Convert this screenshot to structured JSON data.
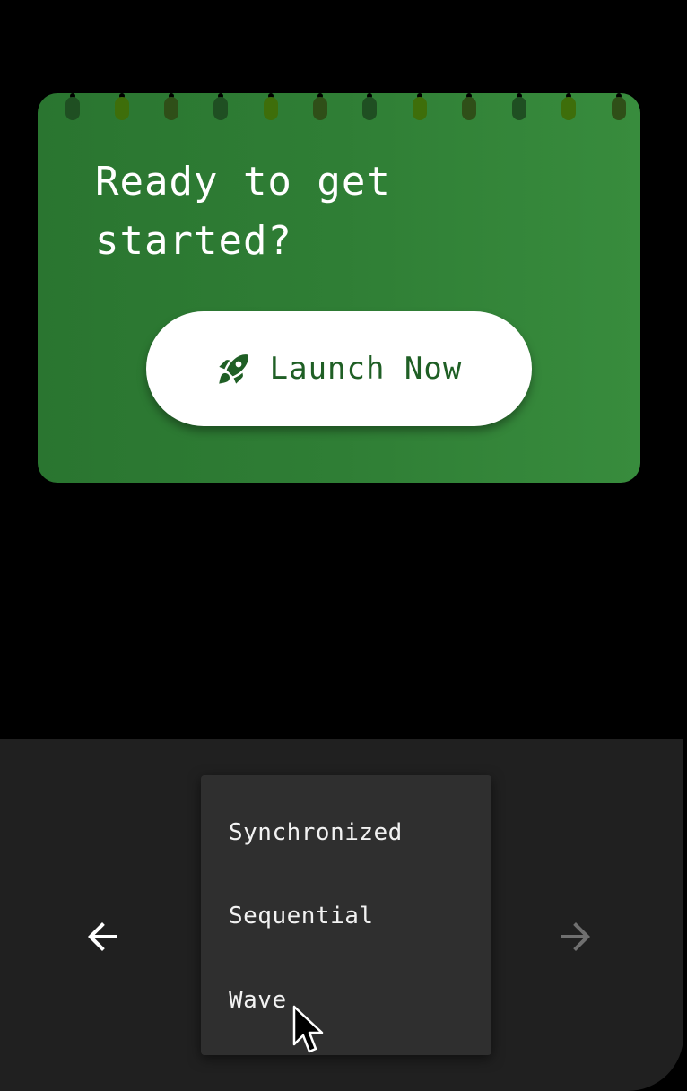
{
  "card": {
    "title": "Ready to get started?",
    "button_label": "Launch Now",
    "button_icon": "rocket-icon",
    "background_color": "#2f7e35",
    "ring_colors": [
      "#1f4f22",
      "#3e6e0a",
      "#2f4f18",
      "#1f4f22",
      "#3e6e0a",
      "#2f4f18",
      "#1f4f22",
      "#3e6e0a",
      "#2f4f18",
      "#1f4f22",
      "#3e6e0a",
      "#2f4f18"
    ]
  },
  "navigation": {
    "prev_icon": "arrow-left-icon",
    "next_icon": "arrow-right-icon",
    "prev_color": "#ffffff",
    "next_color": "#707070"
  },
  "menu": {
    "items": [
      {
        "label": "Synchronized"
      },
      {
        "label": "Sequential"
      },
      {
        "label": "Wave"
      }
    ],
    "hovered": "Wave"
  },
  "theme": {
    "page_background": "#000000",
    "panel_background": "#202020",
    "menu_background": "#2f2f2f",
    "button_text_color": "#1f5f25"
  }
}
